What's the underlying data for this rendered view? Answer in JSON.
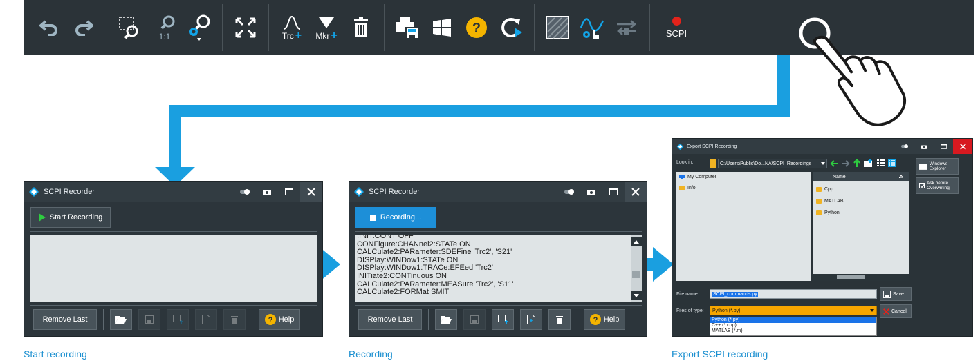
{
  "toolbar": {
    "trace_label": "Trc",
    "marker_label": "Mkr",
    "zoom_1to1_label": "1:1",
    "scpi_label": "SCPI",
    "colors": {
      "background": "#2b3338",
      "icon": "#9fb6c3",
      "accent": "#12a4e8",
      "record_dot": "#e3231b"
    },
    "icons": [
      "undo-icon",
      "redo-icon",
      "zoom-window-icon",
      "zoom-1to1-icon",
      "zoom-config-icon",
      "fullscreen-icon",
      "add-trace-icon",
      "add-marker-icon",
      "delete-icon",
      "print-save-icon",
      "windows-icon",
      "help-icon",
      "restart-icon",
      "display-icon",
      "touch-icon",
      "transfer-icon",
      "scpi-record-icon"
    ]
  },
  "captions": {
    "start": "Start recording",
    "recording": "Recording",
    "export": "Export SCPI recording"
  },
  "dialog1": {
    "title": "SCPI Recorder",
    "start_button": "Start Recording",
    "remove_last": "Remove Last",
    "help": "Help"
  },
  "dialog2": {
    "title": "SCPI Recorder",
    "recording_button": "Recording...",
    "remove_last": "Remove Last",
    "help": "Help",
    "lines": [
      ":INIT:CONT OFF",
      "CONFigure:CHANnel2:STATe ON",
      "CALCulate2:PARameter:SDEFine 'Trc2', 'S21'",
      "DISPlay:WINDow1:STATe ON",
      "DISPlay:WINDow1:TRACe:EFEed 'Trc2'",
      "INITiate2:CONTinuous ON",
      "CALCulate2:PARameter:MEASure 'Trc2', 'S11'",
      "CALCulate2:FORMat SMIT"
    ]
  },
  "dialog3": {
    "title": "Export SCPI Recording",
    "look_in_label": "Look in:",
    "path": "C:\\Users\\Public\\Do...NA\\SCPI_Recordings",
    "left_items": [
      "My Computer",
      "Info"
    ],
    "name_header": "Name",
    "folders": [
      "Cpp",
      "MATLAB",
      "Python"
    ],
    "windows_explorer": "Windows Explorer",
    "ask_overwrite": "Ask before Overwriting",
    "file_name_label": "File name:",
    "file_name": "SCPI_commands.py",
    "save": "Save",
    "files_of_type_label": "Files of type:",
    "file_type": "Python (*.py)",
    "cancel": "Cancel",
    "type_options": [
      "Python (*.py)",
      "C++ (*.cpp)",
      "MATLAB (*.m)"
    ]
  }
}
